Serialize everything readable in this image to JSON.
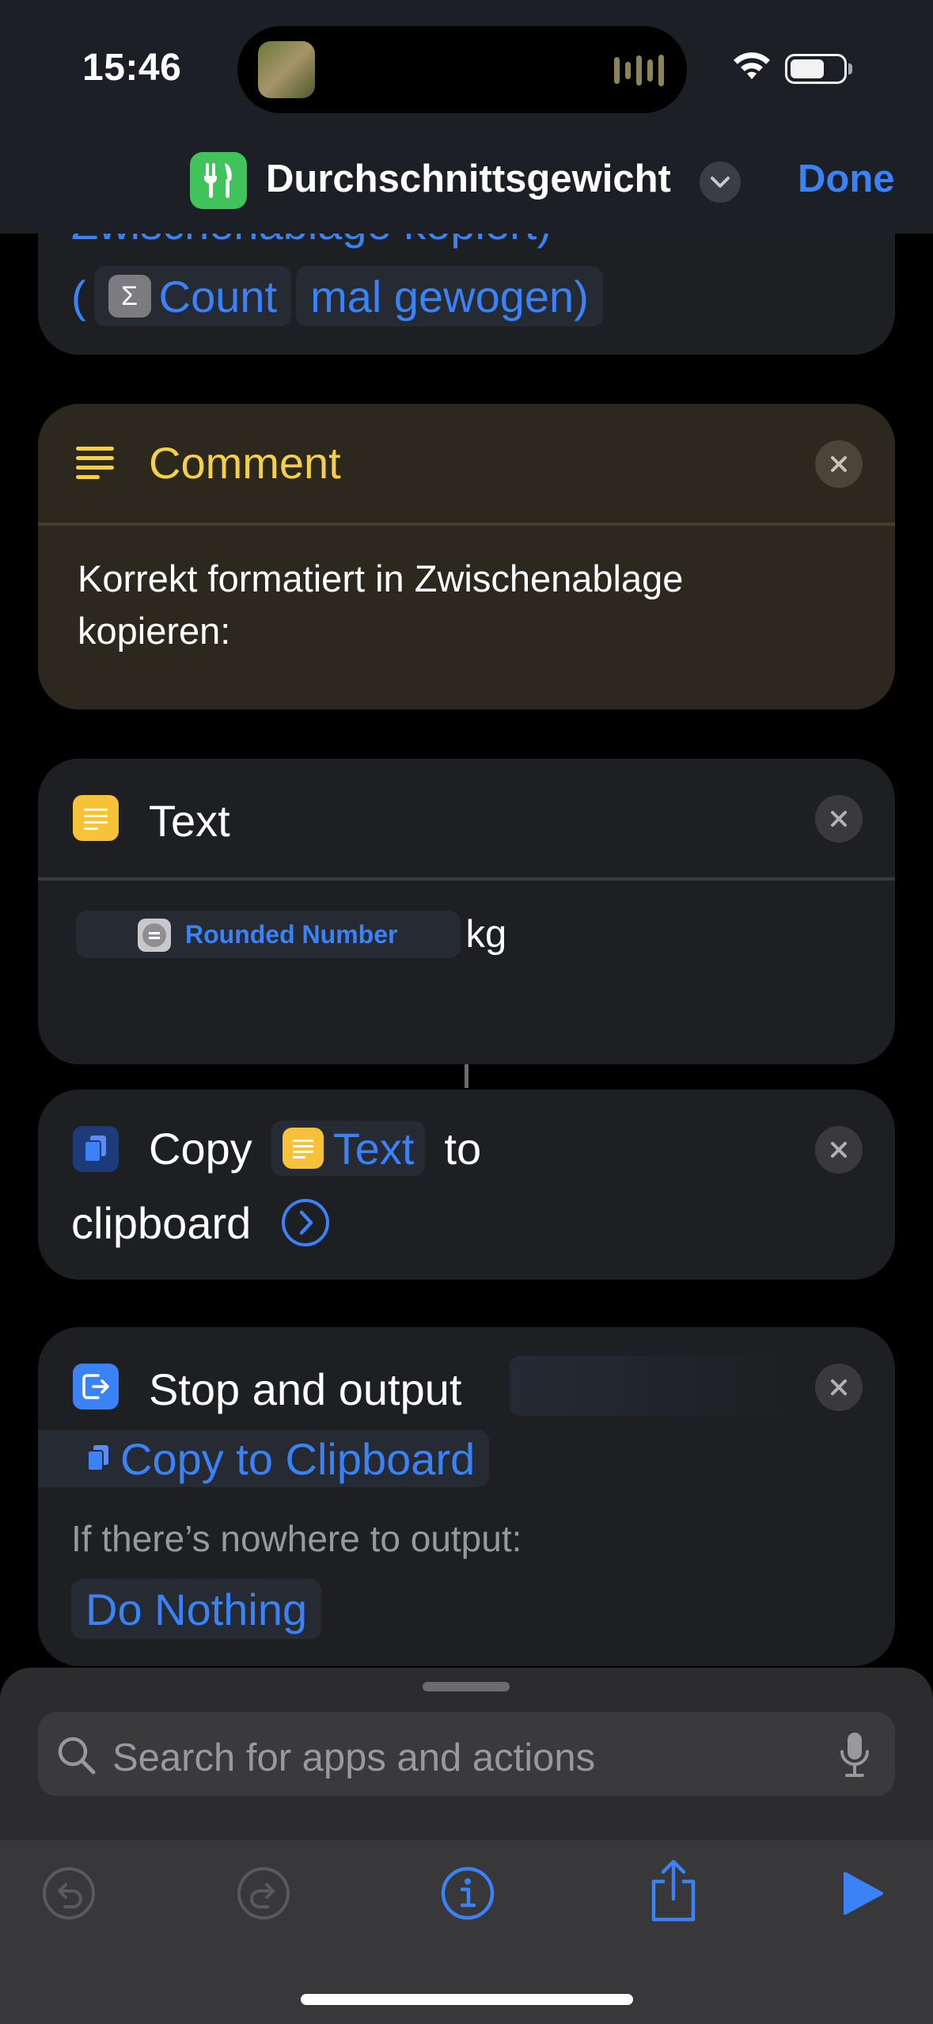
{
  "status": {
    "time": "15:46"
  },
  "nav": {
    "title": "Durchschnittsgewicht",
    "done_label": "Done"
  },
  "prev_card": {
    "line1_partial": "Zwischenablage kopiert)",
    "paren_open": "(",
    "variable": "Count",
    "suffix": "mal gewogen)"
  },
  "comment": {
    "title": "Comment",
    "text": "Korrekt formatiert in Zwischenablage kopieren:"
  },
  "text_action": {
    "title": "Text",
    "variable": "Rounded Number",
    "unit": "kg"
  },
  "copy_action": {
    "word_copy": "Copy",
    "variable": "Text",
    "word_to": "to",
    "word_clipboard": "clipboard"
  },
  "stop_action": {
    "title": "Stop and output",
    "output_variable": "Copy to Clipboard",
    "nowhere_label": "If there’s nowhere to output:",
    "nowhere_value": "Do Nothing"
  },
  "search": {
    "placeholder": "Search for apps and actions"
  },
  "colors": {
    "accent": "#3b82f6",
    "comment_title": "#f5cf47",
    "app_icon": "#3fc35a",
    "text_icon": "#f7c23a"
  },
  "icons": [
    "fork-knife-icon",
    "chevron-down-icon",
    "sigma-icon",
    "lines-icon",
    "close-icon",
    "document-icon",
    "clipboard-icon",
    "arrow-circle-icon",
    "exit-icon",
    "search-icon",
    "microphone-icon",
    "undo-icon",
    "redo-icon",
    "info-icon",
    "share-icon",
    "play-icon"
  ]
}
